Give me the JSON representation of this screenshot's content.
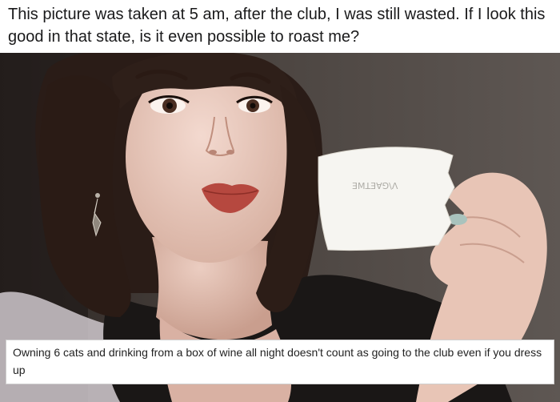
{
  "post": {
    "title": "This picture was taken at 5 am, after the club, I was still wasted. If I look this good in that state, is it even possible to roast me?"
  },
  "photo": {
    "note_text": "ƎMꓕƎꓯ⅁\\ꓥ"
  },
  "reply": {
    "comment": "Owning 6 cats and drinking from a box of wine all night doesn't count as going to the club even if you dress up"
  },
  "colors": {
    "background": "#ffffff",
    "title_text": "#1a1a1b",
    "comment_text": "#222222",
    "comment_border": "#cfcfcf"
  }
}
